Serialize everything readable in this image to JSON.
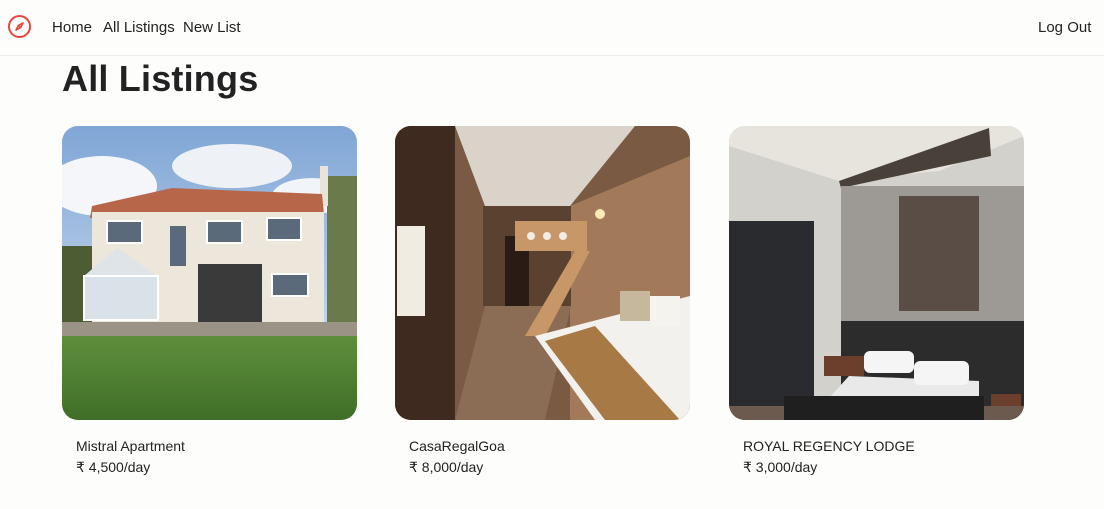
{
  "nav": {
    "logo_icon": "compass-icon",
    "links": {
      "home": "Home",
      "all_listings": "All Listings",
      "new_list": "New List"
    },
    "logout": "Log Out",
    "accent": "#e8453c"
  },
  "page": {
    "title": "All Listings"
  },
  "listings": [
    {
      "title": "Mistral Apartment",
      "price": "₹ 4,500/day",
      "image": "house-exterior-photo"
    },
    {
      "title": "CasaRegalGoa",
      "price": "₹ 8,000/day",
      "image": "bunk-bedroom-photo"
    },
    {
      "title": "ROYAL REGENCY LODGE",
      "price": "₹ 3,000/day",
      "image": "modern-bedroom-photo"
    }
  ]
}
